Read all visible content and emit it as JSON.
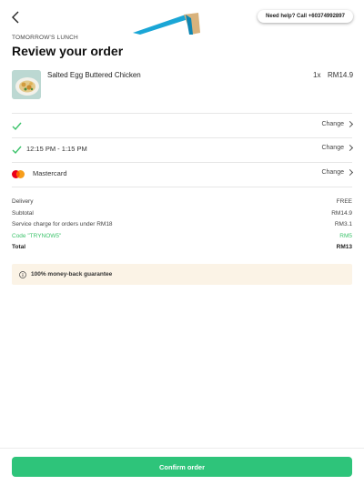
{
  "header": {
    "help_label": "Need help? Call +60374992897",
    "eyebrow": "TOMORROW'S LUNCH",
    "title": "Review your order"
  },
  "order_item": {
    "name": "Salted Egg Buttered Chicken",
    "qty": "1x",
    "price": "RM14.9"
  },
  "options": [
    {
      "label": "",
      "change_label": "Change",
      "icon": "check-icon"
    },
    {
      "label": "12:15 PM - 1:15 PM",
      "change_label": "Change",
      "icon": "check-icon"
    },
    {
      "label": "Mastercard",
      "change_label": "Change",
      "icon": "mastercard-icon"
    }
  ],
  "summary": [
    {
      "label": "Delivery",
      "value": "FREE"
    },
    {
      "label": "Subtotal",
      "value": "RM14.9"
    },
    {
      "label": "Service charge for orders under RM18",
      "value": "RM3.1"
    },
    {
      "label": "Code \"TRYNOW5\"",
      "value": "RM5"
    },
    {
      "label": "Total",
      "value": "RM13"
    }
  ],
  "guarantee_label": "100% money-back guarantee",
  "confirm_label": "Confirm order",
  "colors": {
    "accent": "#2ec47a",
    "check": "#3cc36b",
    "banner": "#fbf3e6"
  }
}
